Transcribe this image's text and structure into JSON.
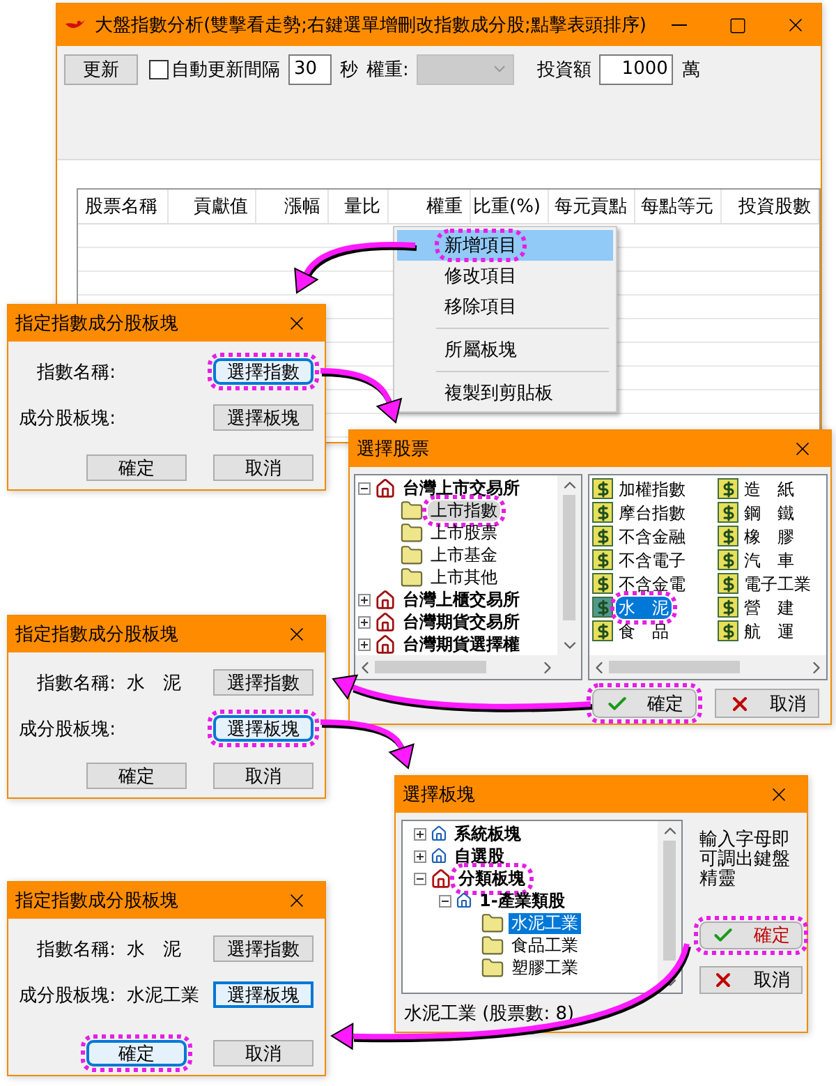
{
  "main_window": {
    "title": "大盤指數分析(雙擊看走勢;右鍵選單增刪改指數成分股;點擊表頭排序)",
    "refresh_button": "更新",
    "auto_update": {
      "label": "自動更新間隔",
      "checked": false
    },
    "interval": "30",
    "interval_unit": "秒",
    "weight_label": "權重:",
    "weight_select": {
      "disabled": true
    },
    "investment_label": "投資額",
    "investment": "1000",
    "investment_unit": "萬",
    "table": {
      "columns": [
        "股票名稱",
        "貢獻值",
        "漲幅",
        "量比",
        "權重",
        "比重(%)",
        "每元貢點",
        "每點等元",
        "投資股數"
      ]
    }
  },
  "context_menu": {
    "items": [
      {
        "kind": "item",
        "label": "新增項目",
        "selected": true,
        "highlighted": true
      },
      {
        "kind": "item",
        "label": "修改項目",
        "selected": false,
        "highlighted": false
      },
      {
        "kind": "item",
        "label": "移除項目",
        "selected": false,
        "highlighted": false
      },
      {
        "kind": "separator"
      },
      {
        "kind": "item",
        "label": "所屬板塊",
        "selected": false,
        "highlighted": false
      },
      {
        "kind": "separator"
      },
      {
        "kind": "item",
        "label": "複製到剪貼板",
        "selected": false,
        "highlighted": false
      }
    ]
  },
  "index_dialogs": [
    {
      "title": "指定指數成分股板塊",
      "rows": [
        {
          "label": "指數名稱:",
          "button": {
            "label": "選擇指數",
            "focused": true,
            "highlighted": true
          }
        },
        {
          "label": "成分股板塊:",
          "button": {
            "label": "選擇板塊",
            "focused": false,
            "highlighted": false
          }
        }
      ],
      "ok": {
        "label": "確定",
        "focused": false,
        "highlighted": false
      },
      "cancel": {
        "label": "取消",
        "focused": false,
        "highlighted": false
      }
    },
    {
      "title": "指定指數成分股板塊",
      "rows": [
        {
          "label": "指數名稱:",
          "value": "水　泥",
          "button": {
            "label": "選擇指數",
            "focused": false,
            "highlighted": false
          }
        },
        {
          "label": "成分股板塊:",
          "button": {
            "label": "選擇板塊",
            "focused": true,
            "highlighted": true
          }
        }
      ],
      "ok": {
        "label": "確定",
        "focused": false,
        "highlighted": false
      },
      "cancel": {
        "label": "取消",
        "focused": false,
        "highlighted": false
      }
    },
    {
      "title": "指定指數成分股板塊",
      "rows": [
        {
          "label": "指數名稱:",
          "value": "水　泥",
          "button": {
            "label": "選擇指數",
            "focused": false,
            "highlighted": false
          }
        },
        {
          "label": "成分股板塊:",
          "value": "水泥工業",
          "button": {
            "label": "選擇板塊",
            "focused": true,
            "highlighted": false
          }
        }
      ],
      "ok": {
        "label": "確定",
        "focused": true,
        "highlighted": true
      },
      "cancel": {
        "label": "取消",
        "focused": false,
        "highlighted": false
      }
    }
  ],
  "stock_picker": {
    "title": "選擇股票",
    "tree": [
      {
        "kind": "exchange",
        "label": "台灣上市交易所",
        "expanded": true,
        "selected": false,
        "highlighted": false,
        "children": [
          {
            "kind": "folder",
            "label": "上市指數",
            "selected": true,
            "highlighted": true
          },
          {
            "kind": "folder",
            "label": "上市股票",
            "selected": false,
            "highlighted": false
          },
          {
            "kind": "folder",
            "label": "上市基金",
            "selected": false,
            "highlighted": false
          },
          {
            "kind": "folder",
            "label": "上市其他",
            "selected": false,
            "highlighted": false
          }
        ]
      },
      {
        "kind": "exchange",
        "label": "台灣上櫃交易所",
        "expanded": false,
        "selected": false,
        "highlighted": false
      },
      {
        "kind": "exchange",
        "label": "台灣期貨交易所",
        "expanded": false,
        "selected": false,
        "highlighted": false
      },
      {
        "kind": "exchange",
        "label": "台灣期貨選擇權",
        "expanded": false,
        "selected": false,
        "highlighted": false
      }
    ],
    "stocks": [
      {
        "label": "加權指數",
        "selected": false,
        "highlighted": false
      },
      {
        "label": "摩台指數",
        "selected": false,
        "highlighted": false
      },
      {
        "label": "不含金融",
        "selected": false,
        "highlighted": false
      },
      {
        "label": "不含電子",
        "selected": false,
        "highlighted": false
      },
      {
        "label": "不含金電",
        "selected": false,
        "highlighted": false
      },
      {
        "label": "水　泥",
        "selected": true,
        "highlighted": true
      },
      {
        "label": "食　品",
        "selected": false,
        "highlighted": false
      },
      {
        "label": "造　紙",
        "selected": false,
        "highlighted": false
      },
      {
        "label": "鋼　鐵",
        "selected": false,
        "highlighted": false
      },
      {
        "label": "橡　膠",
        "selected": false,
        "highlighted": false
      },
      {
        "label": "汽　車",
        "selected": false,
        "highlighted": false
      },
      {
        "label": "電子工業",
        "selected": false,
        "highlighted": false
      },
      {
        "label": "營　建",
        "selected": false,
        "highlighted": false
      },
      {
        "label": "航　運",
        "selected": false,
        "highlighted": false
      }
    ],
    "ok": {
      "label": "確定",
      "focused": false,
      "highlighted": true
    },
    "cancel": {
      "label": "取消",
      "focused": false,
      "highlighted": false
    }
  },
  "sector_picker": {
    "title": "選擇板塊",
    "tree": [
      {
        "kind": "root",
        "label": "系統板塊",
        "expanded": false,
        "selected": false,
        "highlighted": false
      },
      {
        "kind": "root",
        "label": "自選股",
        "expanded": false,
        "selected": false,
        "highlighted": false
      },
      {
        "kind": "category",
        "label": "分類板塊",
        "expanded": true,
        "selected": false,
        "highlighted": true,
        "children": [
          {
            "kind": "group",
            "label": "1-產業類股",
            "expanded": true,
            "selected": false,
            "highlighted": false,
            "children": [
              {
                "kind": "folder",
                "label": "水泥工業",
                "selected": true,
                "highlighted": false
              },
              {
                "kind": "folder",
                "label": "食品工業",
                "selected": false,
                "highlighted": false
              },
              {
                "kind": "folder",
                "label": "塑膠工業",
                "selected": false,
                "highlighted": false
              }
            ]
          }
        ]
      }
    ],
    "hint": "輸入字母即可調出鍵盤精靈",
    "ok": {
      "label": "確定",
      "focused": false,
      "highlighted": true
    },
    "cancel": {
      "label": "取消",
      "focused": false,
      "highlighted": false
    },
    "status": "水泥工業 (股票數: 8)"
  }
}
